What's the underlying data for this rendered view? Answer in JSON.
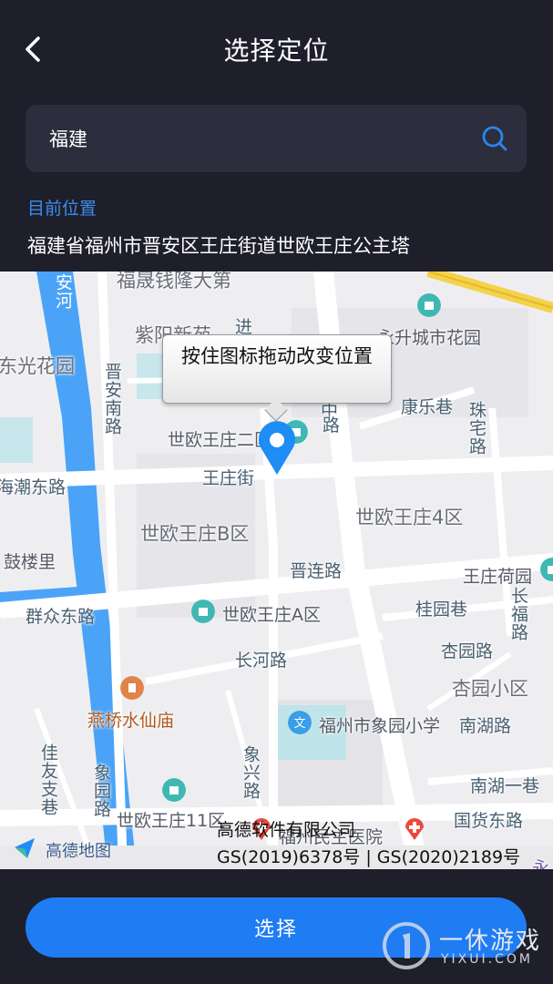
{
  "header": {
    "title": "选择定位"
  },
  "search": {
    "value": "福建"
  },
  "location": {
    "label": "目前位置",
    "address": "福建省福州市晋安区王庄街道世欧王庄公主塔"
  },
  "map": {
    "tooltip": "按住图标拖动改变位置",
    "labels": {
      "fucheng": "福晟钱隆大第",
      "ziyang": "紫阳新苑",
      "jin": "进",
      "yongsheng": "永升城市花园",
      "dongguang": "东光花园",
      "anhe": "安河",
      "jinan_road": "晋安南路",
      "kangle": "康乐巷",
      "zhuzhai": "珠宅路",
      "shiou2": "世欧王庄二区",
      "zhong": "中",
      "lu": "路",
      "haichao": "海潮东路",
      "wangzhuang_st": "王庄街",
      "shiou4": "世欧王庄4区",
      "shioub": "世欧王庄B区",
      "gulou": "鼓楼里",
      "jinlian": "晋连路",
      "wangzhuang_he": "王庄荷园",
      "qunzhong": "群众东路",
      "shioua": "世欧王庄A区",
      "guiyuan": "桂园巷",
      "changfu": "长福路",
      "xingyuan_road": "杏园路",
      "changhe": "长河路",
      "xingyuan_area": "杏园小区",
      "yanqiao": "燕桥水仙庙",
      "xiangyuan_school": "福州市象园小学",
      "nanhu": "南湖路",
      "jiayou": "佳友支巷",
      "xiangyuan_road": "象园路",
      "xiangxing": "象兴路",
      "nanhu1": "南湖一巷",
      "shiou11": "世欧王庄11区",
      "hospital": "福州民主医院",
      "guohuo": "国货东路",
      "yong": "永"
    },
    "logo_text": "高德地图",
    "copyright_company": "高德软件有限公司",
    "copyright_numbers": "GS(2019)6378号 | GS(2020)2189号"
  },
  "actions": {
    "select_label": "选择"
  },
  "watermark": {
    "text": "一休游戏",
    "domain": "YIXUI.COM"
  },
  "colors": {
    "background": "#1e1f2b",
    "search_bg": "#2c2e3d",
    "accent": "#1f7cf3",
    "label_blue": "#3b8cf0",
    "pin": "#1e8df5"
  }
}
